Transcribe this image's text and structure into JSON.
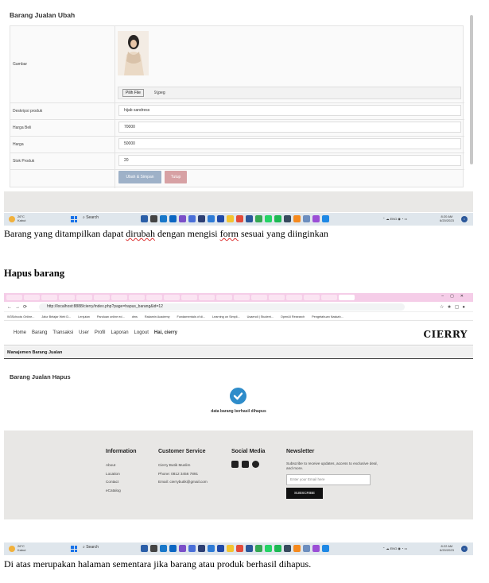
{
  "screenshot1": {
    "title": "Barang Jualan Ubah",
    "labels": {
      "image": "Gambar",
      "description": "Deskripsi produk",
      "buy_price": "Harga Beli",
      "price": "Harga",
      "stock": "Stok Produk"
    },
    "file_button": "Pilih File",
    "file_name": "9.jpeg",
    "values": {
      "description": "hijab sandress",
      "buy_price": "70000",
      "price": "50000",
      "stock": "20"
    },
    "buttons": {
      "save": "Ubah & Simpan",
      "close": "Tutup"
    },
    "taskbar": {
      "temp": "26°C",
      "weather": "Kabut",
      "search": "Search",
      "lang": "ENG",
      "time": "8:20 AM",
      "date": "6/20/2023"
    }
  },
  "caption1": {
    "before": "Barang  yang ditampilkan dapat ",
    "w1": "dirubah",
    "middle": " dengan mengisi ",
    "w2": "form",
    "after": " sesuai yang diinginkan"
  },
  "heading": "Hapus barang",
  "screenshot2": {
    "url": "http://localhost:8888/cierry/index.php?page=hapus_barang&id=12",
    "bookmarks": [
      "W3Schools Online...",
      "Jalur Belajar Web D...",
      "Lenjutan",
      "Panduan online ed...",
      "dms",
      "Rakamin Academy",
      "Fundamentals of di...",
      "Learning on Simpli...",
      "Usaendi | Student...",
      "OpenAI Research",
      "Pengetahuan Naskah..."
    ],
    "menu": [
      "Home",
      "Barang",
      "Transaksi",
      "User",
      "Profil",
      "Laporan",
      "Logout"
    ],
    "user": "Hai, cierry",
    "brand": "CIERRY",
    "page_header": "Manajemen Barang Jualan",
    "subtitle": "Barang Jualan Hapus",
    "message": "data barang berhasil dihapus",
    "footer": {
      "information": {
        "title": "Information",
        "items": [
          "About",
          "Location",
          "Contact",
          "eCatalog"
        ]
      },
      "customer_service": {
        "title": "Customer Service",
        "items": [
          "Cierry Butik Muslim",
          "Phone: 0812 3456 7891",
          "Email: cierrybutik@gmail.com"
        ]
      },
      "social_media": {
        "title": "Social Media",
        "icons": [
          "instagram-icon",
          "twitter-icon",
          "facebook-icon"
        ]
      },
      "newsletter": {
        "title": "Newsletter",
        "text": "Subscribe to receive updates, access to exclusive deal, and more.",
        "placeholder": "Enter your Email here",
        "button": "SUBSCRIBE"
      }
    },
    "taskbar": {
      "temp": "26°C",
      "weather": "Kabut",
      "search": "Search",
      "lang": "ENG",
      "time": "8:22 AM",
      "date": "6/20/2023"
    }
  },
  "caption2": "Di atas merupakan halaman sementara jika barang atau produk berhasil dihapus."
}
